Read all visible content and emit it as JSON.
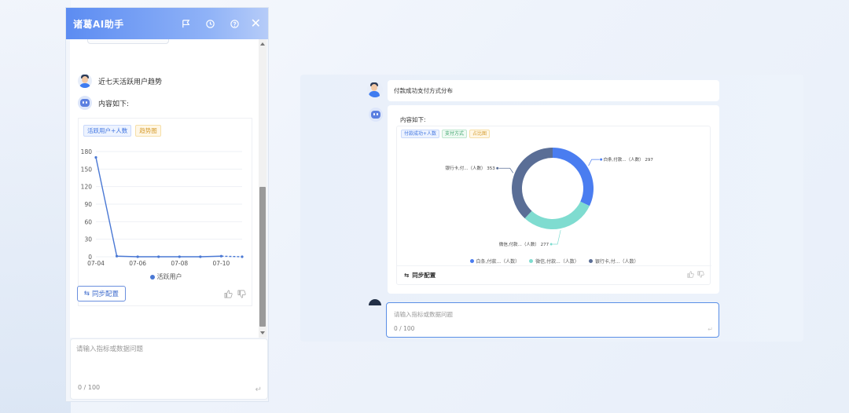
{
  "widget": {
    "title": "诸葛AI助手",
    "header_icons": [
      "flag-icon",
      "history-icon",
      "help-icon",
      "close-icon"
    ],
    "user_question": "近七天活跃用户趋势",
    "bot_reply_intro": "内容如下:",
    "tags": [
      "活跃用户+人数",
      "趋势图"
    ],
    "sync_label": "同步配置",
    "input_placeholder": "请输入指标或数据问题",
    "input_count": "0 / 100"
  },
  "right_panel": {
    "user_question": "付款成功支付方式分布",
    "bot_reply_intro": "内容如下:",
    "tags": [
      "付款成功+人数",
      "支付方式",
      "占比图"
    ],
    "sync_label": "同步配置",
    "input_placeholder": "请输入指标或数据问题",
    "input_count": "0 / 100",
    "input_focus_color": "#5a8fe6"
  },
  "colors": {
    "header_gradient_start": "#5c8cf2",
    "accent_blue": "#4a78d4",
    "donut_blue": "#4a7df0",
    "donut_teal": "#7fdcd0",
    "donut_slate": "#5a6e96"
  },
  "chart_data": [
    {
      "type": "line",
      "title": "",
      "x": [
        "07-04",
        "07-05",
        "07-06",
        "07-07",
        "07-08",
        "07-09",
        "07-10",
        "07-11"
      ],
      "x_tick_labels": [
        "07-04",
        "07-06",
        "07-08",
        "07-10"
      ],
      "series": [
        {
          "name": "活跃用户",
          "values": [
            170,
            1,
            0,
            0,
            0,
            0,
            1,
            0
          ],
          "dashed_last_segment": true
        }
      ],
      "ylim": [
        0,
        180
      ],
      "y_ticks": [
        0,
        30,
        60,
        90,
        120,
        150,
        180
      ],
      "grid": true,
      "legend": "bottom"
    },
    {
      "type": "pie",
      "donut": true,
      "title": "",
      "slices": [
        {
          "label": "白条,付款...（人数）",
          "value": 297,
          "color": "#4a7df0"
        },
        {
          "label": "微信,付款...（人数）",
          "value": 277,
          "color": "#7fdcd0"
        },
        {
          "label": "银行卡,付...（人数）",
          "value": 353,
          "color": "#5a6e96"
        }
      ],
      "legend": "bottom"
    }
  ]
}
